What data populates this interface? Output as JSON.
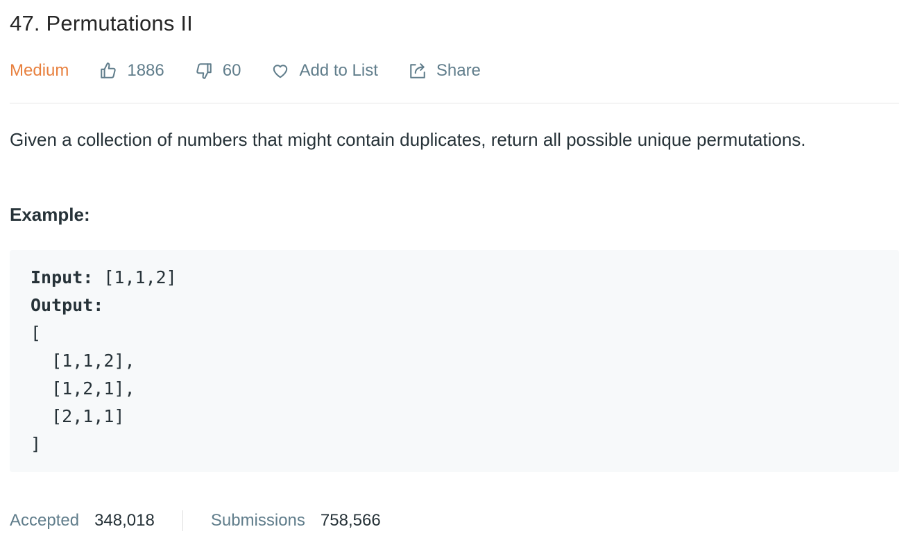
{
  "problem": {
    "title": "47. Permutations II",
    "difficulty": "Medium",
    "likes": "1886",
    "dislikes": "60",
    "add_to_list_label": "Add to List",
    "share_label": "Share",
    "description": "Given a collection of numbers that might contain duplicates, return all possible unique permutations.",
    "example_label": "Example:",
    "example": {
      "input_label": "Input:",
      "input_value": " [1,1,2]",
      "output_label": "Output:",
      "output_lines": "[\n  [1,1,2],\n  [1,2,1],\n  [2,1,1]\n]"
    }
  },
  "stats": {
    "accepted_label": "Accepted",
    "accepted_value": "348,018",
    "submissions_label": "Submissions",
    "submissions_value": "758,566"
  },
  "icons": {
    "like": "thumbs-up-icon",
    "dislike": "thumbs-down-icon",
    "favorite": "heart-icon",
    "share": "share-icon"
  },
  "colors": {
    "difficulty_medium": "#e8803e",
    "meta_text": "#607d8b",
    "code_background": "#f7f9fa"
  }
}
